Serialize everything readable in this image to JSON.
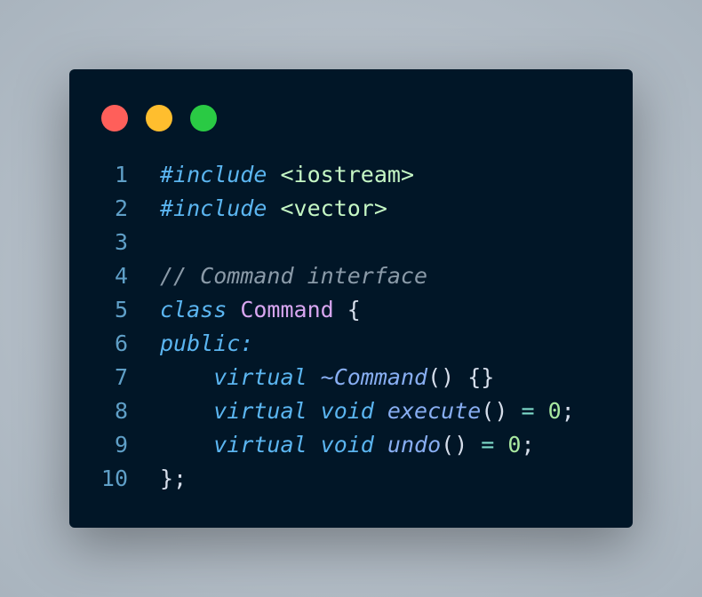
{
  "window": {
    "dots": [
      {
        "name": "close",
        "color": "#ff5f5a"
      },
      {
        "name": "minimize",
        "color": "#ffbe2e"
      },
      {
        "name": "maximize",
        "color": "#2aca44"
      }
    ]
  },
  "code": {
    "lines": [
      {
        "num": "1",
        "tokens": [
          {
            "t": "#include",
            "c": "kw"
          },
          {
            "t": " ",
            "c": "pl"
          },
          {
            "t": "<iostream>",
            "c": "str"
          }
        ]
      },
      {
        "num": "2",
        "tokens": [
          {
            "t": "#include",
            "c": "kw"
          },
          {
            "t": " ",
            "c": "pl"
          },
          {
            "t": "<vector>",
            "c": "str"
          }
        ]
      },
      {
        "num": "3",
        "tokens": []
      },
      {
        "num": "4",
        "tokens": [
          {
            "t": "// Command interface",
            "c": "cmt"
          }
        ]
      },
      {
        "num": "5",
        "tokens": [
          {
            "t": "class",
            "c": "kw"
          },
          {
            "t": " ",
            "c": "pl"
          },
          {
            "t": "Command",
            "c": "cls"
          },
          {
            "t": " {",
            "c": "pl"
          }
        ]
      },
      {
        "num": "6",
        "tokens": [
          {
            "t": "public:",
            "c": "kw"
          }
        ]
      },
      {
        "num": "7",
        "tokens": [
          {
            "t": "    ",
            "c": "pl"
          },
          {
            "t": "virtual",
            "c": "kw"
          },
          {
            "t": " ",
            "c": "pl"
          },
          {
            "t": "~Command",
            "c": "fn"
          },
          {
            "t": "() {}",
            "c": "pl"
          }
        ]
      },
      {
        "num": "8",
        "tokens": [
          {
            "t": "    ",
            "c": "pl"
          },
          {
            "t": "virtual",
            "c": "kw"
          },
          {
            "t": " ",
            "c": "pl"
          },
          {
            "t": "void",
            "c": "kw"
          },
          {
            "t": " ",
            "c": "pl"
          },
          {
            "t": "execute",
            "c": "fn"
          },
          {
            "t": "() ",
            "c": "pl"
          },
          {
            "t": "=",
            "c": "op"
          },
          {
            "t": " ",
            "c": "pl"
          },
          {
            "t": "0",
            "c": "num"
          },
          {
            "t": ";",
            "c": "pl"
          }
        ]
      },
      {
        "num": "9",
        "tokens": [
          {
            "t": "    ",
            "c": "pl"
          },
          {
            "t": "virtual",
            "c": "kw"
          },
          {
            "t": " ",
            "c": "pl"
          },
          {
            "t": "void",
            "c": "kw"
          },
          {
            "t": " ",
            "c": "pl"
          },
          {
            "t": "undo",
            "c": "fn"
          },
          {
            "t": "() ",
            "c": "pl"
          },
          {
            "t": "=",
            "c": "op"
          },
          {
            "t": " ",
            "c": "pl"
          },
          {
            "t": "0",
            "c": "num"
          },
          {
            "t": ";",
            "c": "pl"
          }
        ]
      },
      {
        "num": "10",
        "tokens": [
          {
            "t": "};",
            "c": "pl"
          }
        ]
      }
    ]
  }
}
